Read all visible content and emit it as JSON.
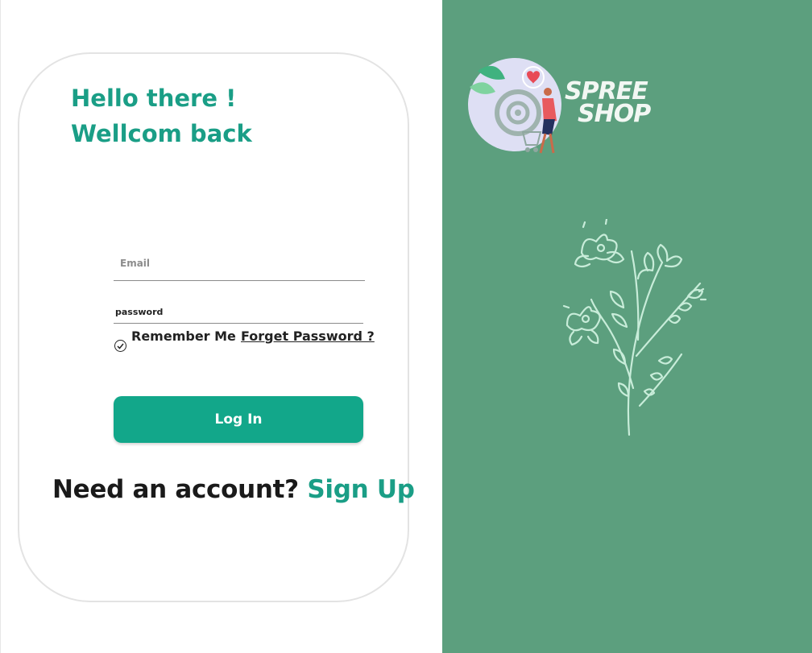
{
  "login": {
    "greeting_line1": "Hello there !",
    "greeting_line2": "Wellcom back",
    "email_placeholder": "Email",
    "password_placeholder": "password",
    "remember_label": "Remember Me",
    "forgot_label": "Forget Password ?",
    "login_label": "Log In",
    "signup_prompt": "Need an account?",
    "signup_label": "Sign Up"
  },
  "brand": {
    "logo_line1": "SPREE",
    "logo_line2": "SHOP",
    "background_color": "#5c9f7e",
    "accent_color": "#12a78a"
  },
  "icons": {
    "remember": "check-circle-icon",
    "logo": "shopping-logo-icon",
    "illustration": "flower-illustration-icon"
  }
}
